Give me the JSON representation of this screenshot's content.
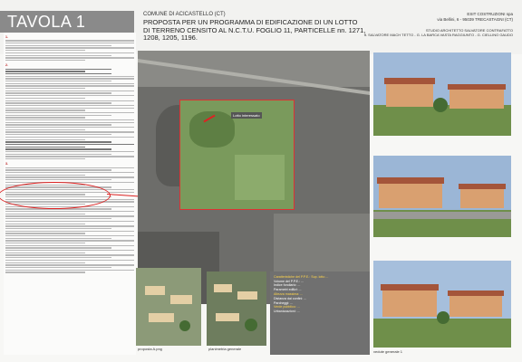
{
  "header": {
    "tavola": "TAVOLA 1",
    "comune": "COMUNE DI ACICASTELLO (CT)",
    "proposta_line1": "PROPOSTA PER UN PROGRAMMA DI EDIFICAZIONE DI UN LOTTO",
    "proposta_line2": "DI TERRENO CENSITO AL N.C.T.U. FOGLIO 11, PARTICELLE nn. 1271, 1208, 1205, 1196.",
    "firm_line1": "ESIT COSTRUZIONI spa",
    "firm_line2": "via Bellini, 6 - 95039 TRECASTAGNI (CT)",
    "arch_line1": "STUDIO ARCHITETTO SALVATORE CONTRAFATTO",
    "arch_line2": "ft. SALVATORE MACH TETTO - G. LA BARCA VASTA RAGGIUNTO - G. CIELLINO GAUDO"
  },
  "map": {
    "label": "Lotto interessato"
  },
  "info_panel": {
    "lines": [
      "Caratteristiche del P.P.E.: Sup. lotto ...",
      "Volume del P.P.E.: ...",
      "Indice fondiario: ...",
      "Parametri edilizi: ...",
      "Altezza massima: ...",
      "Distanza dai confini: ...",
      "Parcheggi: ...",
      "Verde pubblico: ...",
      "Urbanizzazioni: ..."
    ]
  },
  "captions": {
    "a": "proposta A.png",
    "b": "planimetria generale",
    "c": "vedute generale 1"
  }
}
